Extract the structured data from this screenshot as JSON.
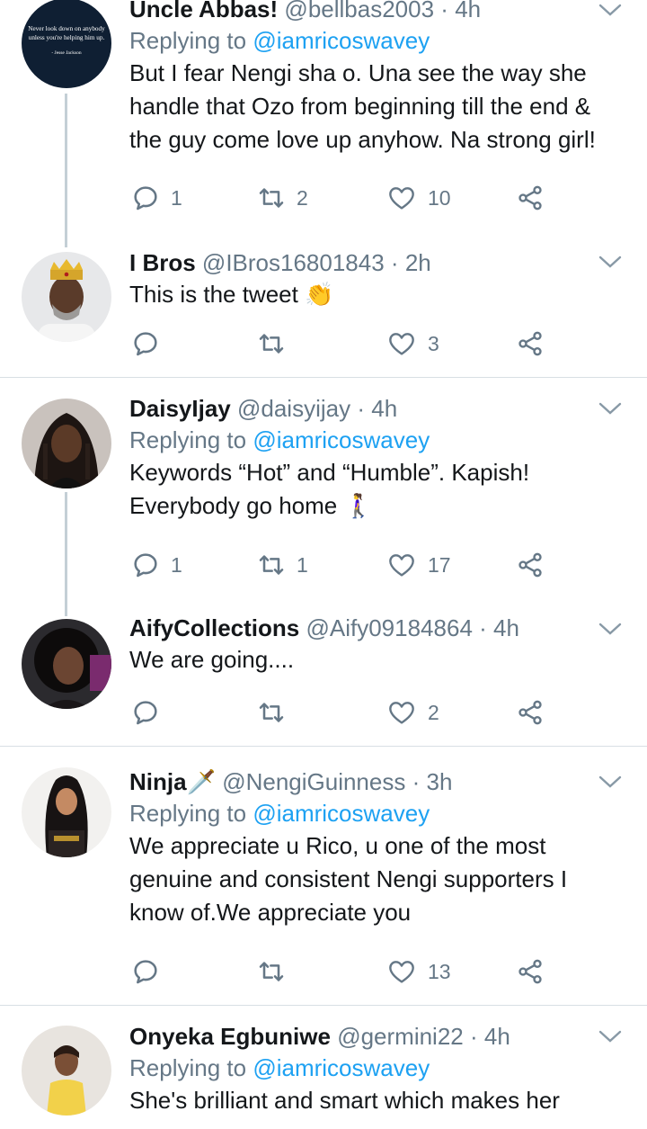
{
  "tweets": [
    {
      "name": "Uncle Abbas!",
      "handle": "@bellbas2003",
      "time": "4h",
      "reply_prefix": "Replying to",
      "reply_to": "@iamricoswavey",
      "text_lines": [
        "But I fear Nengi sha o. Una see the way she",
        "handle that Ozo from beginning till the end &",
        "the guy come love up anyhow. Na strong girl!"
      ],
      "replies": "1",
      "retweets": "2",
      "likes": "10",
      "avatar_quote": [
        "Never look down on anybody",
        "unless you're helping him up.",
        "- Jesse Jackson"
      ]
    },
    {
      "name": "I Bros",
      "handle": "@IBros16801843",
      "time": "2h",
      "text_lines": [
        "This is the tweet 👏"
      ],
      "replies": "",
      "retweets": "",
      "likes": "3"
    },
    {
      "name": "DaisyIjay",
      "handle": "@daisyijay",
      "time": "4h",
      "reply_prefix": "Replying to",
      "reply_to": "@iamricoswavey",
      "text_lines": [
        "Keywords “Hot” and “Humble”. Kapish!",
        "Everybody go home 🚶‍♀️"
      ],
      "replies": "1",
      "retweets": "1",
      "likes": "17"
    },
    {
      "name": "AifyCollections",
      "handle": "@Aify09184864",
      "time": "4h",
      "text_lines": [
        "We are going...."
      ],
      "replies": "",
      "retweets": "",
      "likes": "2"
    },
    {
      "name": "Ninja🗡️",
      "handle": "@NengiGuinness",
      "time": "3h",
      "reply_prefix": "Replying to",
      "reply_to": "@iamricoswavey",
      "text_lines": [
        "We appreciate u Rico, u one of the most",
        "genuine and consistent Nengi supporters I",
        "know of.We appreciate you"
      ],
      "replies": "",
      "retweets": "",
      "likes": "13"
    },
    {
      "name": "Onyeka Egbuniwe",
      "handle": "@germini22",
      "time": "4h",
      "reply_prefix": "Replying to",
      "reply_to": "@iamricoswavey",
      "text_lines": [
        "She's brilliant and smart which makes her"
      ]
    }
  ],
  "separator": "·",
  "colors": {
    "accent": "#1da1f2",
    "muted": "#657786",
    "text": "#14171a",
    "divider": "#d8dfe4"
  }
}
